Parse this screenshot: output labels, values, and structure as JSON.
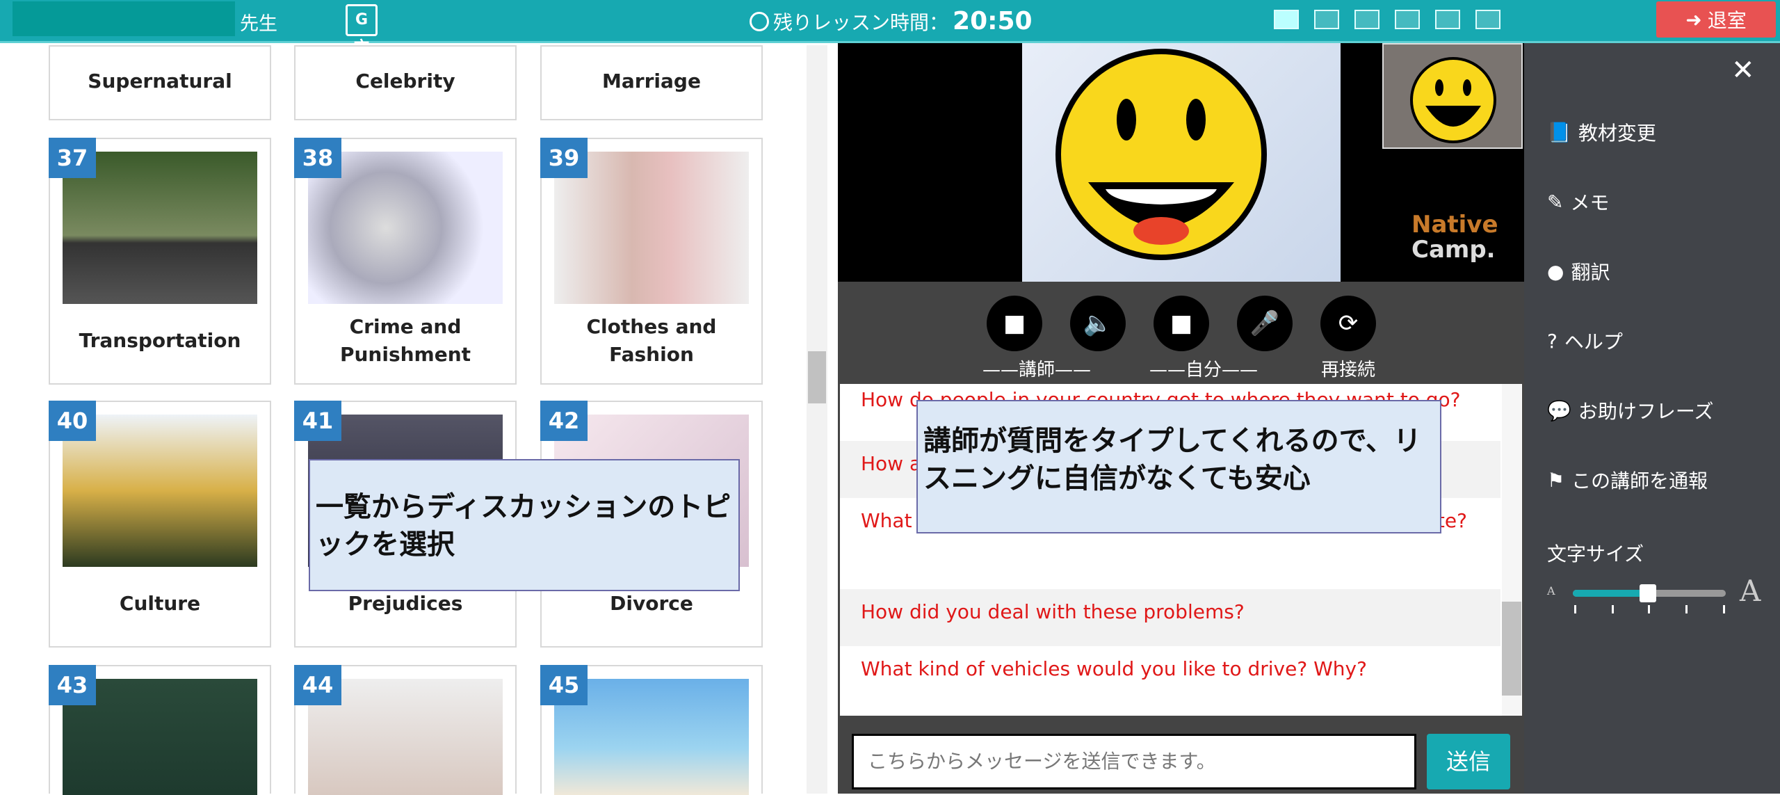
{
  "header": {
    "teacher_suffix": "先生",
    "translate_icon": "translate-icon",
    "timer_label": "残りレッスン時間：",
    "timer_value": "20:50",
    "exit_label": "退室"
  },
  "cards_top_row": [
    "Supernatural",
    "Celebrity",
    "Marriage"
  ],
  "cards": [
    {
      "num": "37",
      "label": "Transportation",
      "img": "car"
    },
    {
      "num": "38",
      "label": "Crime and Punishment",
      "img": "handcuffs"
    },
    {
      "num": "39",
      "label": "Clothes and Fashion",
      "img": "dress"
    },
    {
      "num": "40",
      "label": "Culture",
      "img": "temple"
    },
    {
      "num": "41",
      "label": "Prejudices",
      "img": "street"
    },
    {
      "num": "42",
      "label": "Divorce",
      "img": "ring"
    },
    {
      "num": "43",
      "label": "",
      "img": "teacher"
    },
    {
      "num": "44",
      "label": "",
      "img": "girl"
    },
    {
      "num": "45",
      "label": "",
      "img": "beach"
    }
  ],
  "video": {
    "logo_1": "Native",
    "logo_2": "Camp."
  },
  "controls": {
    "teacher": "講師",
    "self": "自分",
    "reconnect": "再接続"
  },
  "chat": {
    "messages": [
      "How do people in your country get to where they want to go?",
      "How a",
      "What common problems do you encounter on your commute?",
      "How did you deal with these problems?",
      "What kind of vehicles would you like to drive? Why?"
    ],
    "placeholder": "こちらからメッセージを送信できます。",
    "send": "送信"
  },
  "sidebar": {
    "items": [
      "教材変更",
      "メモ",
      "翻訳",
      "ヘルプ",
      "お助けフレーズ",
      "この講師を通報"
    ],
    "font_size_label": "文字サイズ",
    "font_size_level": 0.5,
    "small_a": "A",
    "large_a": "A"
  },
  "overlays": {
    "left": "一覧からディスカッションのトピックを選択",
    "right": "講師が質問をタイプしてくれるので、リスニングに自信がなくても安心"
  },
  "colors": {
    "accent": "#17a9b1",
    "exit": "#e85252",
    "badge": "#2f7fc1",
    "question": "#e01818"
  }
}
